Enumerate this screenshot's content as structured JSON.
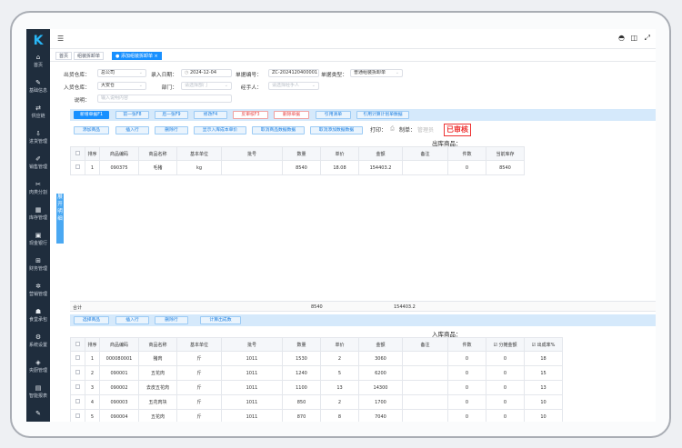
{
  "app": {
    "logo": "K"
  },
  "topbar": {
    "menu_icon": "menu-fold-icon",
    "right_icons": [
      "user-switch-icon",
      "layout-icon",
      "fullscreen-icon"
    ]
  },
  "sidebar": {
    "items": [
      {
        "label": "首页",
        "icon": "⌂"
      },
      {
        "label": "基础信息",
        "icon": "✎"
      },
      {
        "label": "供应链",
        "icon": "⇄"
      },
      {
        "label": "进货管理",
        "icon": "⇩"
      },
      {
        "label": "销售管理",
        "icon": "✐"
      },
      {
        "label": "肉类分割",
        "icon": "✂"
      },
      {
        "label": "库存管理",
        "icon": "▦"
      },
      {
        "label": "现金银行",
        "icon": "▣"
      },
      {
        "label": "财务管理",
        "icon": "⊞"
      },
      {
        "label": "营销管理",
        "icon": "✲"
      },
      {
        "label": "食堂承包",
        "icon": "☗"
      },
      {
        "label": "系统设置",
        "icon": "⚙"
      },
      {
        "label": "央厨管理",
        "icon": "◈"
      },
      {
        "label": "智能报表",
        "icon": "▤"
      },
      {
        "label": "",
        "icon": "✎"
      }
    ]
  },
  "tabs": [
    {
      "label": "首页"
    },
    {
      "label": "组装拆卸单"
    },
    {
      "label": "● 添加组装拆卸单 ×"
    }
  ],
  "form": {
    "out_wh_label": "出货仓库：",
    "out_wh_value": "总公司",
    "date_label": "录入日期：",
    "date_value": "2024-12-04",
    "no_label": "单据编号：",
    "no_value": "ZC-2024120400001",
    "type_label": "单据类型：",
    "type_value": "普通组装拆卸单",
    "in_wh_label": "入货仓库：",
    "in_wh_value": "大安仓",
    "dept_label": "部门：",
    "dept_placeholder": "请选择部门",
    "handler_label": "经手人：",
    "handler_placeholder": "请选择经手人",
    "note_label": "说明：",
    "note_placeholder": "输入说明内容"
  },
  "expand_tab": "展开明细",
  "toolbar1": [
    "新增单据F1",
    "前一张F8",
    "后一张F9",
    "修改F4",
    "反审核F3",
    "删除单据",
    "引用清单",
    "引用计算计划单数据"
  ],
  "toolbar2": [
    "添加商品",
    "插入行",
    "删除行",
    "显示入库成本单价",
    "取消商品数据数据",
    "取消添加数据数据"
  ],
  "print": {
    "print_label": "打印：",
    "maker_label": "制单：",
    "maker_value": "管理员"
  },
  "stamp": "已审核",
  "out_section": {
    "title": "出库商品：",
    "headers": [
      "",
      "排序",
      "商品编码",
      "商品名称",
      "基本单位",
      "批号",
      "数量",
      "单价",
      "金额",
      "备注",
      "件数",
      "当前库存"
    ],
    "rows": [
      [
        "",
        "1",
        "090375",
        "毛猪",
        "kg",
        "",
        "8540",
        "18.08",
        "154403.2",
        "",
        "0",
        "8540"
      ]
    ],
    "total_label": "合计",
    "total_qty": "8540",
    "total_amount": "154403.2"
  },
  "toolbar3": [
    "选择商品",
    "插入行",
    "删除行",
    "计算出成数"
  ],
  "in_section": {
    "title": "入库商品：",
    "headers": [
      "",
      "排序",
      "商品编码",
      "商品名称",
      "基本单位",
      "批号",
      "数量",
      "单价",
      "金额",
      "备注",
      "件数",
      "☑ 分摊金额",
      "☑ 出成率%"
    ],
    "rows": [
      [
        "",
        "1",
        "000080001",
        "猪肉",
        "斤",
        "1011",
        "1530",
        "2",
        "3060",
        "",
        "0",
        "0",
        "18"
      ],
      [
        "",
        "2",
        "090001",
        "五花肉",
        "斤",
        "1011",
        "1240",
        "5",
        "6200",
        "",
        "0",
        "0",
        "15"
      ],
      [
        "",
        "3",
        "090002",
        "去皮五花肉",
        "斤",
        "1011",
        "1100",
        "13",
        "14300",
        "",
        "0",
        "0",
        "13"
      ],
      [
        "",
        "4",
        "090003",
        "五花肉块",
        "斤",
        "1011",
        "850",
        "2",
        "1700",
        "",
        "0",
        "0",
        "10"
      ],
      [
        "",
        "5",
        "090004",
        "五花肉",
        "斤",
        "1011",
        "870",
        "8",
        "7040",
        "",
        "0",
        "0",
        "10"
      ]
    ]
  }
}
